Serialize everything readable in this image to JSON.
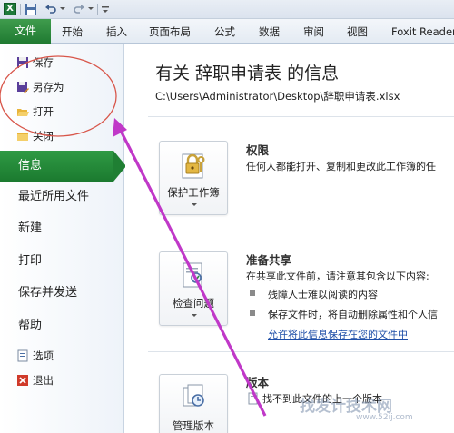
{
  "quick_access": {
    "excel_icon": "X",
    "icons": [
      "excel-icon",
      "save-icon",
      "undo-icon",
      "redo-icon"
    ]
  },
  "ribbon": {
    "tabs": [
      "文件",
      "开始",
      "插入",
      "页面布局",
      "公式",
      "数据",
      "审阅",
      "视图",
      "Foxit Reader"
    ]
  },
  "sidebar": {
    "top_items": [
      "保存",
      "另存为",
      "打开",
      "关闭"
    ],
    "selected": "信息",
    "items": [
      "最近所用文件",
      "新建",
      "打印",
      "保存并发送",
      "帮助"
    ],
    "bottom_items": [
      "选项",
      "退出"
    ]
  },
  "info": {
    "title": "有关 辞职申请表 的信息",
    "path": "C:\\Users\\Administrator\\Desktop\\辞职申请表.xlsx"
  },
  "sections": {
    "permissions": {
      "button": "保护工作簿",
      "title": "权限",
      "desc": "任何人都能打开、复制和更改此工作簿的任"
    },
    "prepare": {
      "button": "检查问题",
      "title": "准备共享",
      "desc": "在共享此文件前，请注意其包含以下内容:",
      "bullets": [
        "残障人士难以阅读的内容",
        "保存文件时，将自动删除属性和个人信"
      ],
      "link": "允许将此信息保存在您的文件中"
    },
    "versions": {
      "button": "管理版本",
      "title": "版本",
      "desc": "找不到此文件的上一个版本"
    }
  },
  "watermark": {
    "text": "找发计技术网",
    "url": "www.52ij.com"
  },
  "colors": {
    "accent_green": "#1f7a31",
    "annotation": "#c038c8"
  }
}
